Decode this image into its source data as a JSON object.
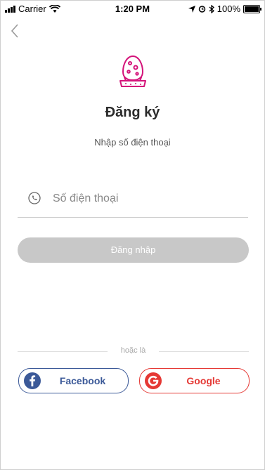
{
  "status_bar": {
    "carrier": "Carrier",
    "time": "1:20 PM",
    "battery": "100%"
  },
  "header": {
    "title": "Đăng ký",
    "subtitle": "Nhập số điện thoại"
  },
  "form": {
    "phone_placeholder": "Số điện thoại",
    "phone_value": "",
    "login_label": "Đăng nhập"
  },
  "divider_text": "hoặc là",
  "social": {
    "facebook_label": "Facebook",
    "google_label": "Google"
  },
  "colors": {
    "brand": "#d4147a",
    "facebook": "#3b5998",
    "google": "#e53935",
    "disabled_button": "#c8c8c8"
  },
  "icons": [
    "signal-icon",
    "wifi-icon",
    "location-icon",
    "alarm-icon",
    "bluetooth-icon",
    "battery-icon",
    "back-chevron-icon",
    "egg-logo-icon",
    "phone-icon",
    "facebook-icon",
    "google-icon"
  ]
}
